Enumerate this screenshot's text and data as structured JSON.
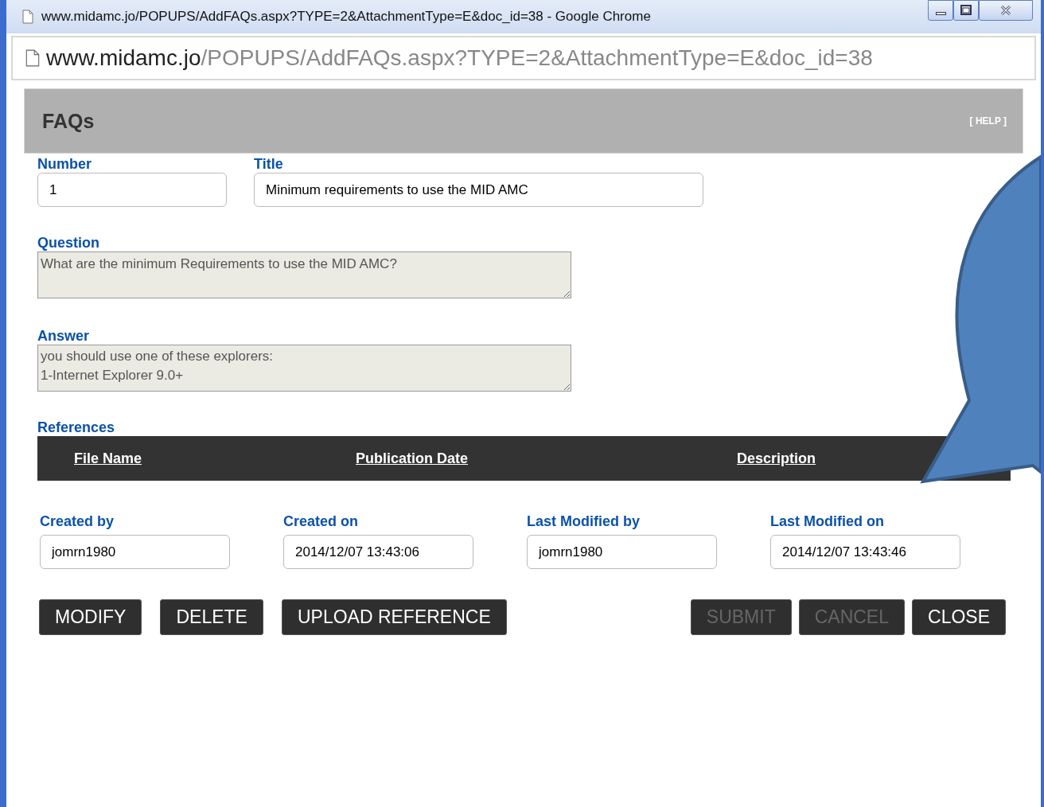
{
  "window": {
    "title": "www.midamc.jo/POPUPS/AddFAQs.aspx?TYPE=2&AttachmentType=E&doc_id=38 - Google Chrome"
  },
  "address_bar": {
    "host": "www.midamc.jo",
    "path": "/POPUPS/AddFAQs.aspx?TYPE=2&AttachmentType=E&doc_id=38"
  },
  "header": {
    "title": "FAQs",
    "help": "[ HELP ]"
  },
  "top_fields": [
    {
      "label": "Number",
      "value": "1"
    },
    {
      "label": "Title",
      "value": "Minimum requirements to use the MID AMC"
    }
  ],
  "question": {
    "label": "Question",
    "value": "What are the minimum Requirements to use the MID AMC?",
    "disabled": true
  },
  "answer": {
    "label": "Answer",
    "value": "you should use one of these explorers:\n1-Internet Explorer 9.0+",
    "disabled": true
  },
  "references": {
    "label": "References",
    "columns": [
      "File Name",
      "Publication Date",
      "Description"
    ]
  },
  "meta_fields": [
    {
      "label": "Created by",
      "value": "jomrn1980"
    },
    {
      "label": "Created on",
      "value": "2014/12/07 13:43:06"
    },
    {
      "label": "Last Modified by",
      "value": "jomrn1980"
    },
    {
      "label": "Last Modified on",
      "value": "2014/12/07 13:43:46"
    }
  ],
  "left_buttons": [
    {
      "label": "MODIFY",
      "disabled": false
    },
    {
      "label": "DELETE",
      "disabled": false
    },
    {
      "label": "UPLOAD REFERENCE",
      "disabled": false
    }
  ],
  "right_buttons": [
    {
      "label": "SUBMIT",
      "disabled": true
    },
    {
      "label": "CANCEL",
      "disabled": true
    },
    {
      "label": "CLOSE",
      "disabled": false
    }
  ]
}
